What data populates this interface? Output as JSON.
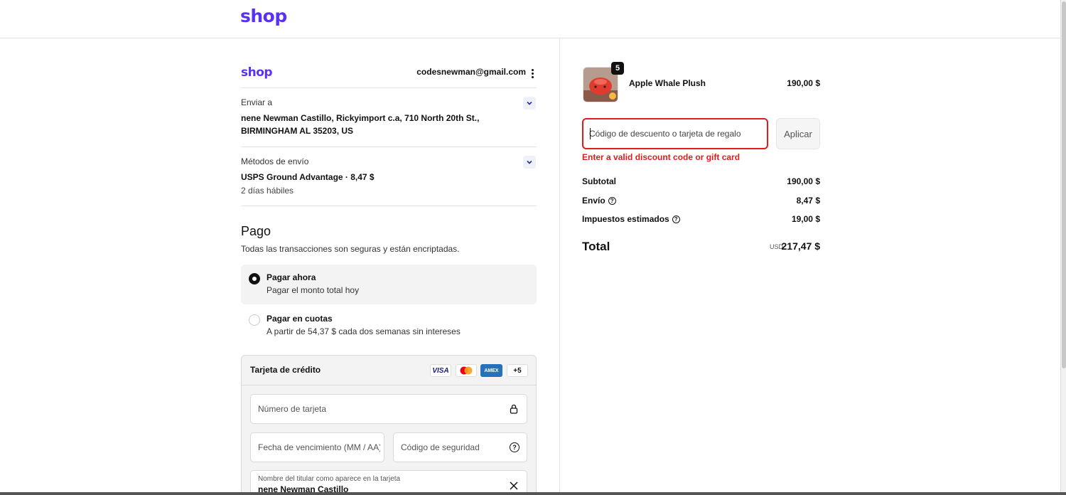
{
  "header": {
    "logo": "shop"
  },
  "account": {
    "logo": "shop",
    "email": "codesnewman@gmail.com"
  },
  "shipping": {
    "label": "Enviar a",
    "address": "nene Newman Castillo, Rickyimport c.a, 710 North 20th St., BIRMINGHAM AL 35203, US"
  },
  "shipping_method": {
    "label": "Métodos de envío",
    "value": "USPS Ground Advantage · 8,47 $",
    "eta": "2 días hábiles"
  },
  "payment": {
    "title": "Pago",
    "subtitle": "Todas las transacciones son seguras y están encriptadas.",
    "options": [
      {
        "title": "Pagar ahora",
        "subtitle": "Pagar el monto total hoy",
        "selected": true
      },
      {
        "title": "Pagar en cuotas",
        "subtitle": "A partir de 54,37 $ cada dos semanas sin intereses",
        "selected": false
      }
    ],
    "card": {
      "title": "Tarjeta de crédito",
      "brands": [
        "VISA",
        "AMEX",
        "+5"
      ],
      "number_placeholder": "Número de tarjeta",
      "expiry_placeholder": "Fecha de vencimiento (MM / AA)",
      "cvv_placeholder": "Código de seguridad",
      "name_label": "Nombre del titular como aparece en la tarjeta",
      "name_value": "nene Newman Castillo"
    }
  },
  "order": {
    "item": {
      "name": "Apple Whale Plush",
      "price": "190,00 $",
      "quantity": "5"
    },
    "discount_placeholder": "Código de descuento o tarjeta de regalo",
    "apply_label": "Aplicar",
    "error": "Enter a valid discount code or gift card",
    "subtotal_label": "Subtotal",
    "subtotal_value": "190,00 $",
    "shipping_label": "Envío",
    "shipping_value": "8,47 $",
    "tax_label": "Impuestos estimados",
    "tax_value": "19,00 $",
    "total_label": "Total",
    "total_currency": "USD",
    "total_value": "217,47 $"
  },
  "colors": {
    "brand": "#5a31f4",
    "error": "#dd1d1d"
  }
}
